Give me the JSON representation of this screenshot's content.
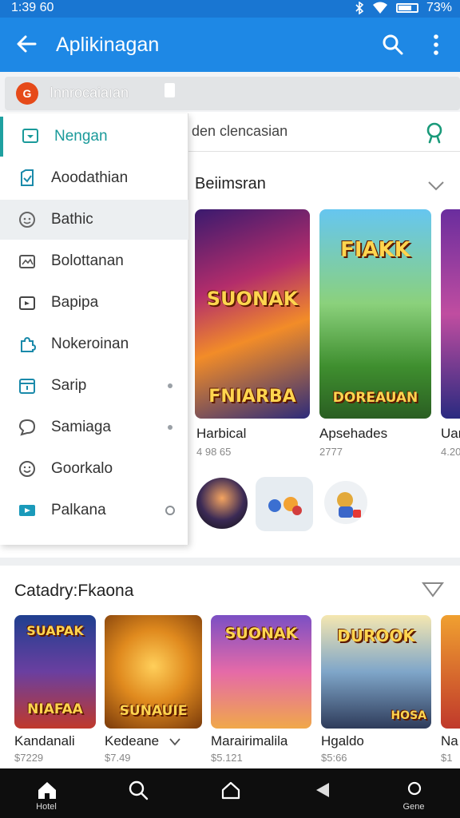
{
  "status": {
    "time": "1:39 60",
    "battery": "73%"
  },
  "app_bar": {
    "title": "Aplikinagan"
  },
  "account": {
    "name": "Innrocaiaıan",
    "logo_letter": "G"
  },
  "search": {
    "placeholder": "den clencasian"
  },
  "drawer": {
    "items": [
      {
        "label": "Nengan",
        "icon": "tablet-icon"
      },
      {
        "label": "Aoodathian",
        "icon": "document-icon"
      },
      {
        "label": "Bathic",
        "icon": "face-icon"
      },
      {
        "label": "Bolottanan",
        "icon": "image-icon"
      },
      {
        "label": "Bapipa",
        "icon": "video-icon"
      },
      {
        "label": "Nokeroinan",
        "icon": "puzzle-icon"
      },
      {
        "label": "Sarip",
        "icon": "calendar-icon"
      },
      {
        "label": "Samiaga",
        "icon": "chat-icon"
      },
      {
        "label": "Goorkalo",
        "icon": "smile-icon"
      },
      {
        "label": "Palkana",
        "icon": "play-icon"
      }
    ]
  },
  "section1": {
    "title": "Beiimsran",
    "cards": [
      {
        "title": "Harbical",
        "sub": "4 98 65",
        "art": "SUONAK",
        "art2": "FNIARBA"
      },
      {
        "title": "Apsehades",
        "sub": "2777",
        "art": "FIAKK",
        "art2": "DOREAUAN"
      },
      {
        "title": "Uar",
        "sub": "4.20"
      }
    ]
  },
  "section2": {
    "title": "Catadry:Fkaona",
    "cards": [
      {
        "title": "Kandanali",
        "sub": "$7229",
        "art": "SUAPAK",
        "art2": "NIAFAA"
      },
      {
        "title": "Kedeane",
        "sub": "$7.49",
        "art": "SUNAUIE"
      },
      {
        "title": "Marairimalila",
        "sub": "$5.121",
        "art": "SUONAK"
      },
      {
        "title": "Hgaldo",
        "sub": "$5:66",
        "art": "DUROOK",
        "art2": "HOSA"
      },
      {
        "title": "Na",
        "sub": "$1"
      }
    ]
  },
  "bottom_nav": {
    "items": [
      {
        "label": "Hotel"
      },
      {
        "label": ""
      },
      {
        "label": ""
      },
      {
        "label": ""
      },
      {
        "label": "Gene"
      }
    ]
  },
  "colors": {
    "app_bar": "#1e88e5",
    "status_bar": "#1976d2",
    "accent_teal": "#1a9a9a",
    "bottom_nav": "#0e0e0e"
  }
}
